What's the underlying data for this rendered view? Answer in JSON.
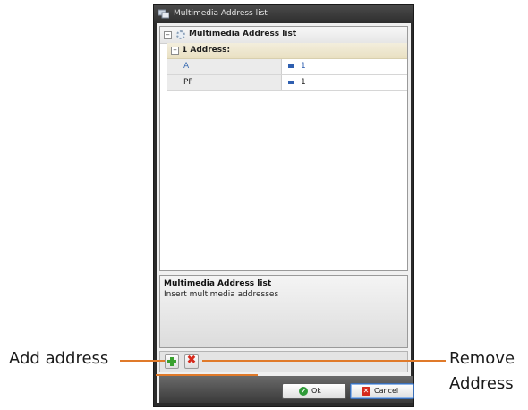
{
  "window": {
    "title": "Multimedia Address list"
  },
  "grid": {
    "header_label": "Multimedia Address list",
    "section_label": "1 Address:",
    "rows": [
      {
        "name": "A",
        "value": "1"
      },
      {
        "name": "PF",
        "value": "1"
      }
    ]
  },
  "description": {
    "title": "Multimedia Address list",
    "text": "Insert multimedia addresses"
  },
  "dialog_buttons": {
    "ok_label": "Ok",
    "cancel_label": "Cancel"
  },
  "callouts": {
    "add": "Add address",
    "remove_line1": "Remove",
    "remove_line2": "Address"
  },
  "colors": {
    "callout_line": "#e07a2a",
    "add_icon": "#39a12f",
    "remove_icon": "#d62a1c",
    "row_name_a": "#3a6bb0",
    "row_name_pf": "#1e1e1e",
    "value_text": "#2f5fb0"
  },
  "icons": {
    "title": "window-app-icon",
    "header": "gear-icon",
    "add": "plus-icon",
    "remove": "x-icon",
    "ok": "check-icon",
    "cancel": "close-icon"
  }
}
